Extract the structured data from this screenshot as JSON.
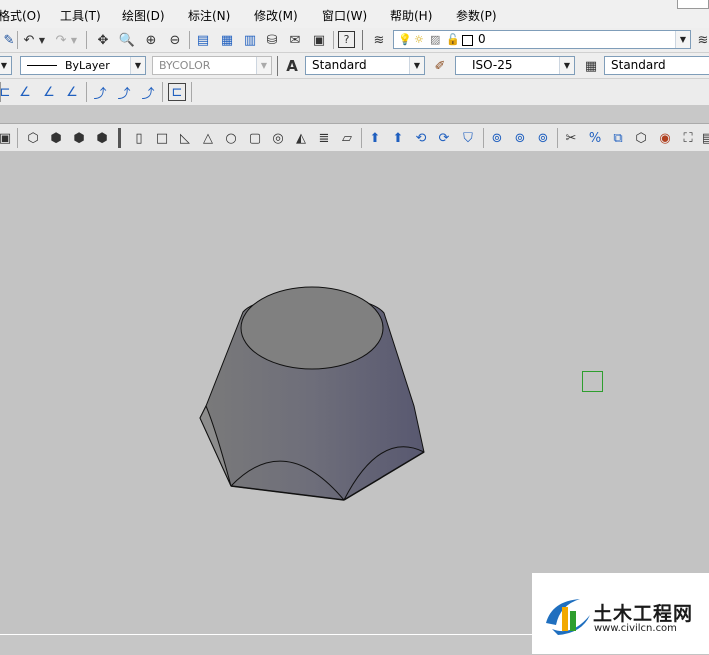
{
  "menu": {
    "items": [
      "格式(O)",
      "工具(T)",
      "绘图(D)",
      "标注(N)",
      "修改(M)",
      "窗口(W)",
      "帮助(H)",
      "参数(P)"
    ]
  },
  "standard_toolbar": {
    "layer_value": "0"
  },
  "properties_toolbar": {
    "linetype": "ByLayer",
    "color": "BYCOLOR",
    "text_style": "Standard",
    "dim_style": "ISO-25",
    "table_style": "Standard"
  },
  "watermark": {
    "brand": "土木工程网",
    "url": "www.civilcn.com"
  },
  "colors": {
    "viewport_bg": "#c3c3c3",
    "toolbar_bg": "#eeeeee",
    "solid_fill": "#7a7a86",
    "pickbox": "#2e9e2e"
  }
}
